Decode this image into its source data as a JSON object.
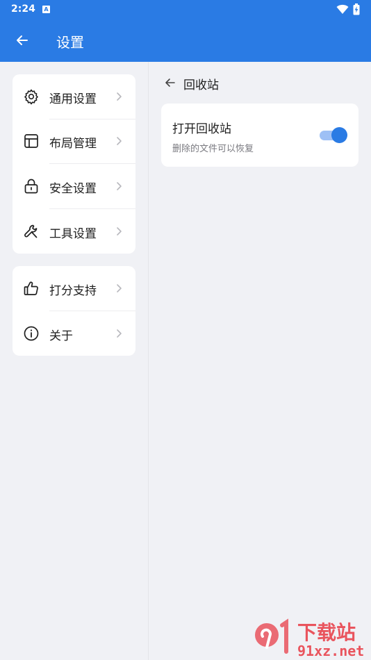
{
  "status_bar": {
    "time": "2:24",
    "notification_glyph": "A"
  },
  "app_bar": {
    "title": "设置",
    "back_icon": "arrow-left-icon"
  },
  "menu_groups": [
    {
      "items": [
        {
          "label": "通用设置",
          "icon": "gear-icon"
        },
        {
          "label": "布局管理",
          "icon": "layout-icon"
        },
        {
          "label": "安全设置",
          "icon": "lock-icon"
        },
        {
          "label": "工具设置",
          "icon": "wrench-icon"
        }
      ]
    },
    {
      "items": [
        {
          "label": "打分支持",
          "icon": "thumbs-up-icon"
        },
        {
          "label": "关于",
          "icon": "info-icon"
        }
      ]
    }
  ],
  "detail": {
    "header_title": "回收站",
    "setting": {
      "title": "打开回收站",
      "description": "删除的文件可以恢复",
      "enabled": true
    }
  },
  "watermark": {
    "logo_text": "下载站",
    "domain": "91xz.net"
  },
  "colors": {
    "primary": "#2a7be4",
    "background": "#f0f1f5",
    "card": "#ffffff",
    "toggle_track": "#9ec0f5"
  }
}
